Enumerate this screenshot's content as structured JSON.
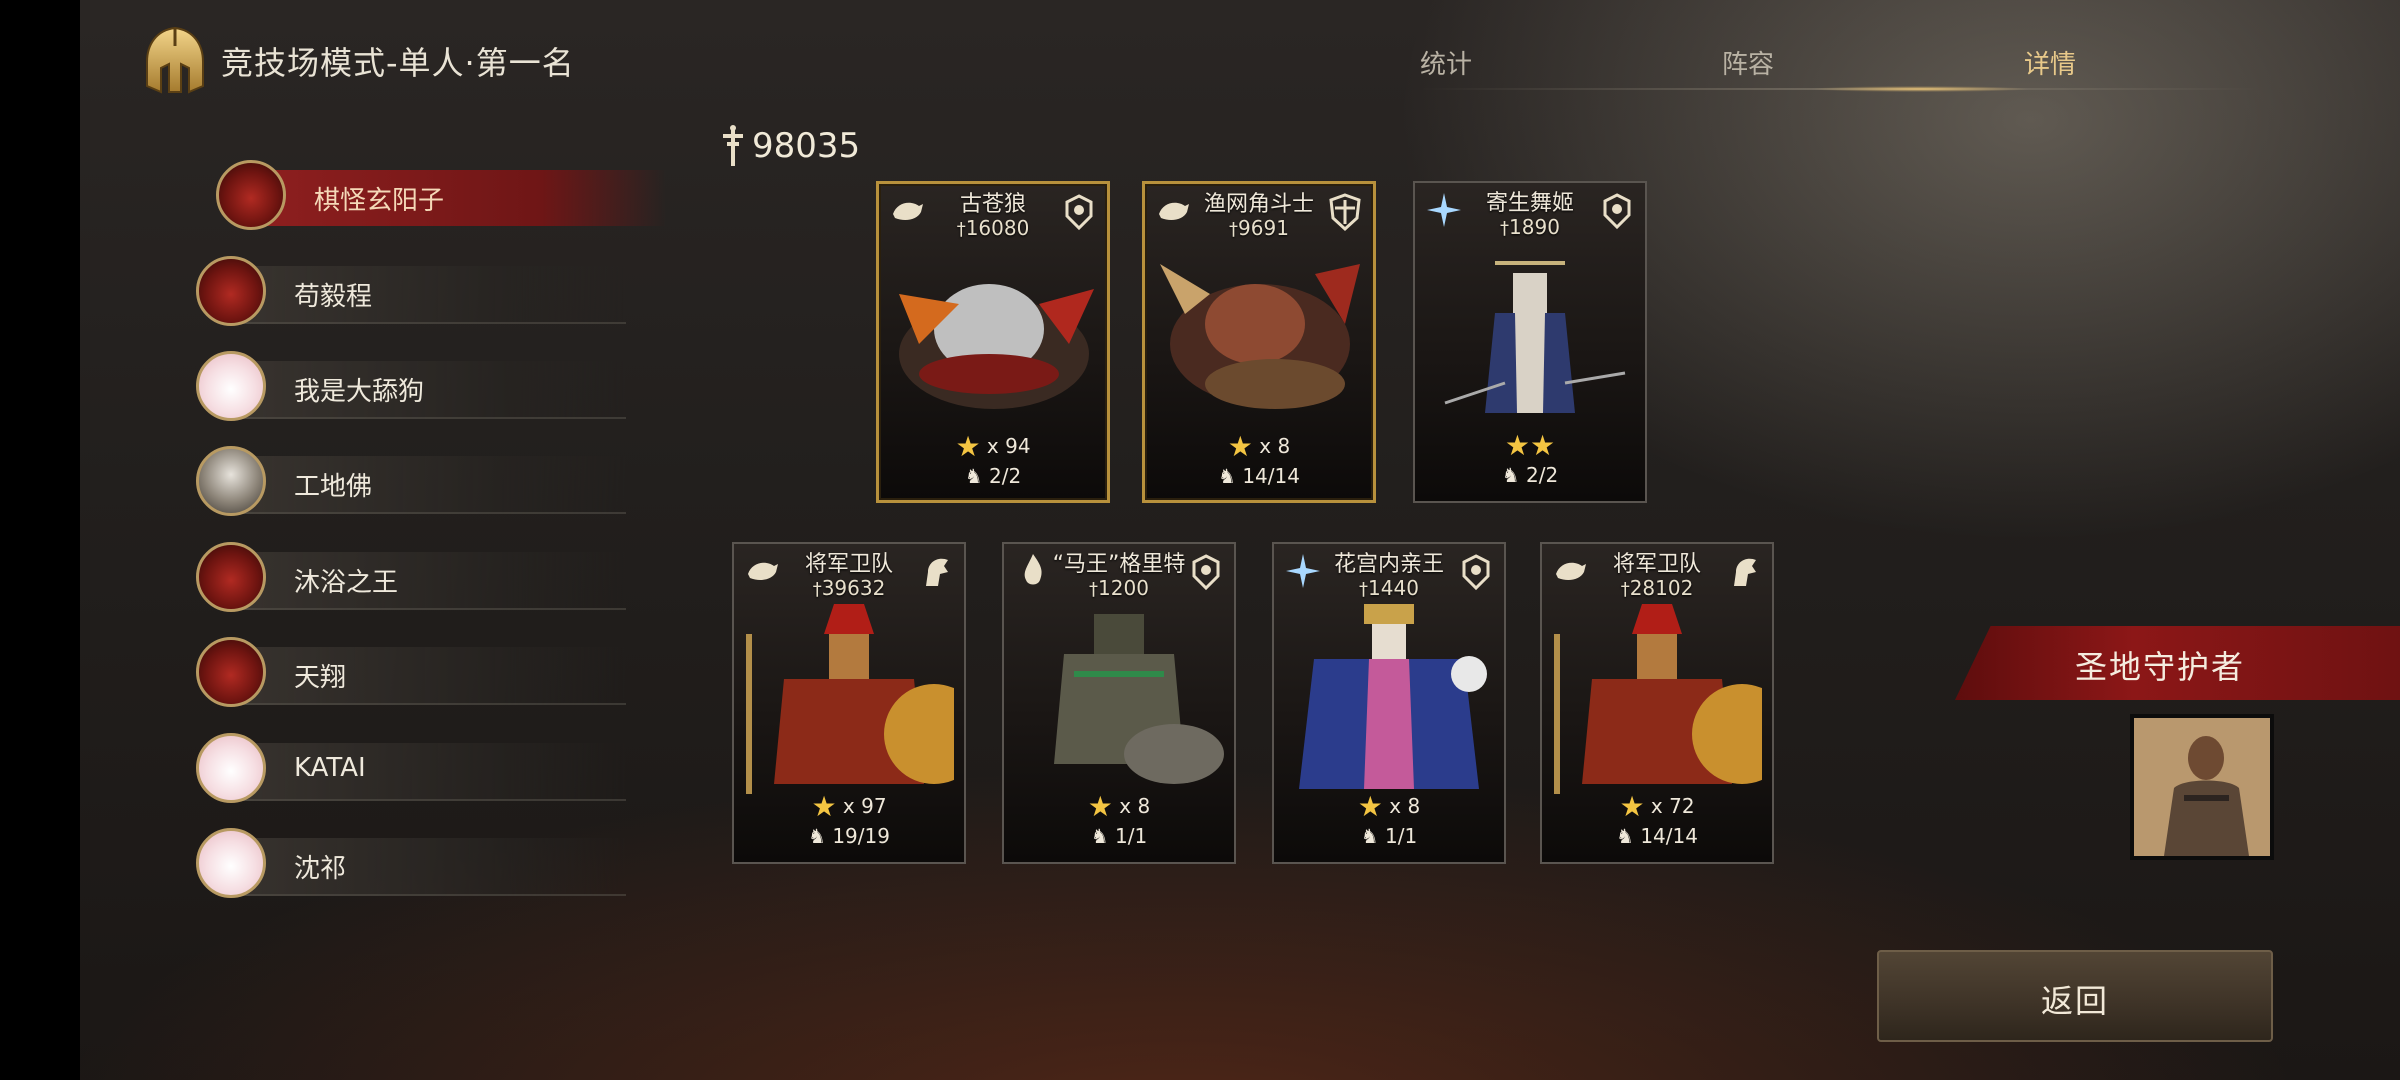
{
  "header": {
    "title": "竞技场模式-单人·第一名",
    "tabs": [
      {
        "label": "统计",
        "active": false
      },
      {
        "label": "阵容",
        "active": false
      },
      {
        "label": "详情",
        "active": true
      }
    ]
  },
  "players": [
    {
      "name": "棋怪玄阳子",
      "avatar": "demon",
      "selected": true
    },
    {
      "name": "苟毅程",
      "avatar": "demon",
      "selected": false
    },
    {
      "name": "我是大舔狗",
      "avatar": "pink",
      "selected": false
    },
    {
      "name": "工地佛",
      "avatar": "pale",
      "selected": false
    },
    {
      "name": "沐浴之王",
      "avatar": "demon",
      "selected": false
    },
    {
      "name": "天翔",
      "avatar": "demon",
      "selected": false
    },
    {
      "name": "KATAI",
      "avatar": "pink",
      "selected": false
    },
    {
      "name": "沈祁",
      "avatar": "pink",
      "selected": false
    }
  ],
  "total_power": "98035",
  "cards": [
    {
      "name": "古苍狼",
      "power": "16080",
      "stars": "x 94",
      "troops": "2/2",
      "icon": "lion-class-icon",
      "role": "skull-icon",
      "border": "gold"
    },
    {
      "name": "渔网角斗士",
      "power": "9691",
      "stars": "x 8",
      "troops": "14/14",
      "icon": "lion-class-icon",
      "role": "shield-icon",
      "border": "gold"
    },
    {
      "name": "寄生舞姬",
      "power": "1890",
      "stars": "",
      "troops": "2/2",
      "icon": "magic-class-icon",
      "role": "skull-icon",
      "border": "plain",
      "star_count": 2
    },
    {
      "name": "将军卫队",
      "power": "39632",
      "stars": "x 97",
      "troops": "19/19",
      "icon": "lion-class-icon",
      "role": "horse-icon",
      "border": "plain"
    },
    {
      "name": "“马王”格里特",
      "power": "1200",
      "stars": "x 8",
      "troops": "1/1",
      "icon": "flame-class-icon",
      "role": "skull-icon",
      "border": "plain"
    },
    {
      "name": "花宫内亲王",
      "power": "1440",
      "stars": "x 8",
      "troops": "1/1",
      "icon": "magic-class-icon",
      "role": "skull-icon",
      "border": "plain"
    },
    {
      "name": "将军卫队",
      "power": "28102",
      "stars": "x 72",
      "troops": "14/14",
      "icon": "lion-class-icon",
      "role": "horse-icon",
      "border": "plain"
    }
  ],
  "banner": {
    "label": "圣地守护者"
  },
  "back_button": {
    "label": "返回"
  }
}
